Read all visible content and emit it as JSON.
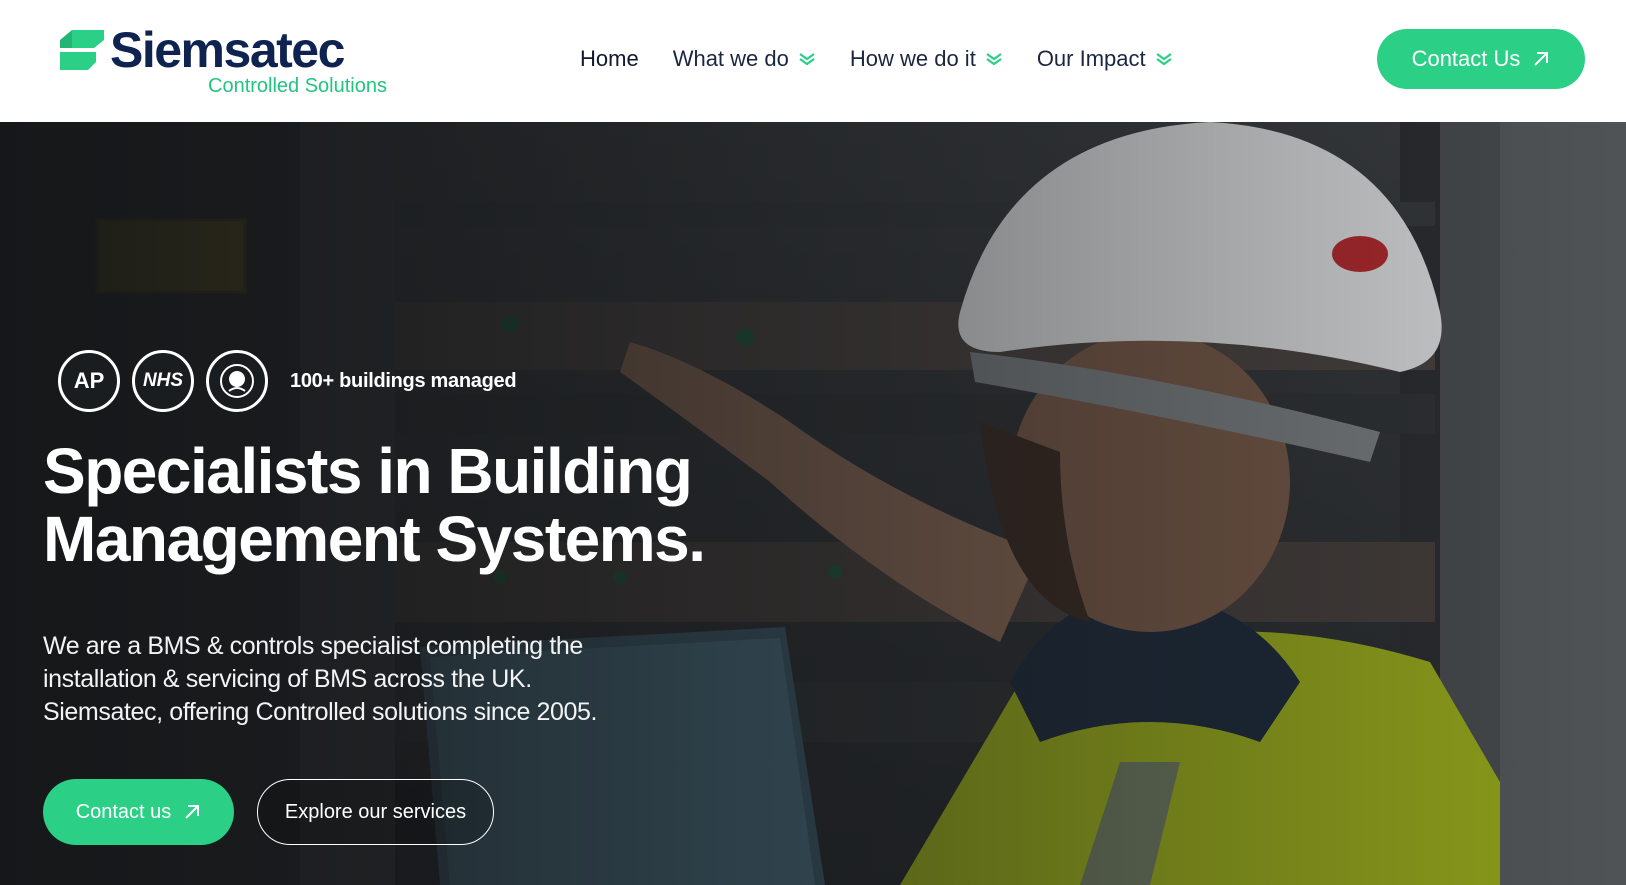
{
  "brand": {
    "name": "Siemsatec",
    "tagline": "Controlled Solutions",
    "color_primary": "#0f2350",
    "color_accent": "#2bcf86"
  },
  "nav": {
    "items": [
      {
        "label": "Home",
        "has_dropdown": false
      },
      {
        "label": "What we do",
        "has_dropdown": true
      },
      {
        "label": "How we do it",
        "has_dropdown": true
      },
      {
        "label": "Our Impact",
        "has_dropdown": true
      }
    ],
    "cta_label": "Contact Us",
    "dropdown_icon": "chevron-double-down-icon",
    "cta_icon": "arrow-up-right-icon"
  },
  "hero": {
    "badges": [
      {
        "label": "AP",
        "icon": "ap-accreditation-logo"
      },
      {
        "label": "NHS",
        "icon": "nhs-logo"
      },
      {
        "label": "",
        "icon": "association-seal-logo"
      }
    ],
    "stat": "100+ buildings managed",
    "title_lines": [
      "Specialists in Building",
      "Management Systems."
    ],
    "description_lines": [
      "We are a BMS & controls specialist completing the",
      "installation & servicing of BMS across the UK.",
      "Siemsatec, offering Controlled solutions since 2005."
    ],
    "primary_button": "Contact us",
    "secondary_button": "Explore our services",
    "background_image": "engineer-in-hardhat-at-control-panel-photo"
  }
}
